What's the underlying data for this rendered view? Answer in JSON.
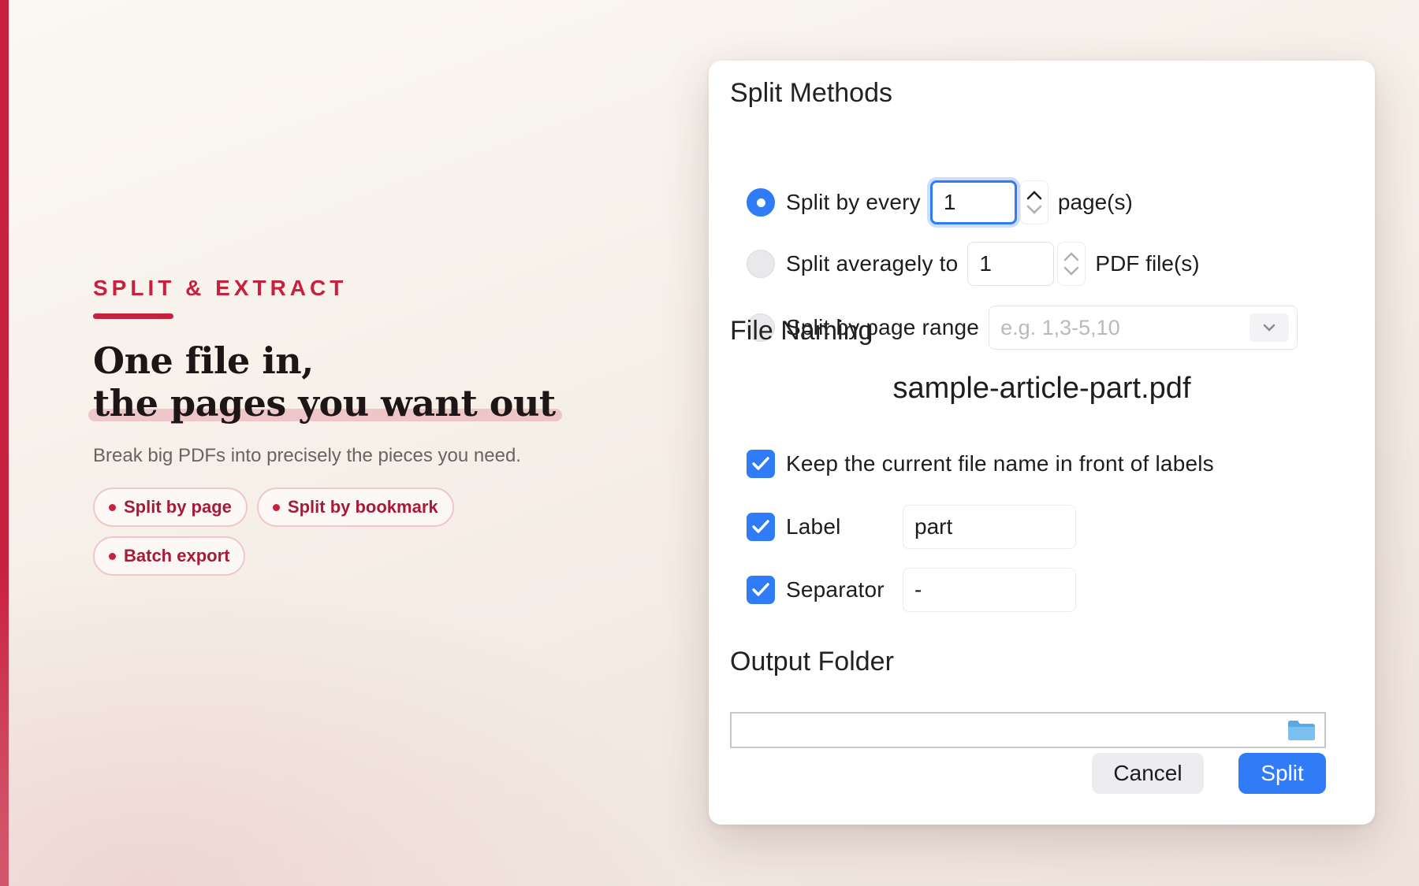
{
  "hero": {
    "eyebrow": "SPLIT & EXTRACT",
    "headline_line1": "One file in,",
    "headline_line2": "the pages you want out",
    "subtitle": "Break big PDFs into precisely the pieces you need.",
    "chips": [
      "Split by page",
      "Split by bookmark",
      "Batch export"
    ]
  },
  "dialog": {
    "split_methods": {
      "title": "Split Methods",
      "every": {
        "label": "Split by every",
        "value": "1",
        "unit": "page(s)",
        "selected": true
      },
      "average": {
        "label": "Split averagely to",
        "value": "1",
        "unit": "PDF file(s)",
        "selected": false
      },
      "range": {
        "label": "Split by page range",
        "placeholder": "e.g. 1,3-5,10",
        "selected": false
      }
    },
    "file_naming": {
      "title": "File Naming",
      "preview": "sample-article-part.pdf",
      "keep_name_label": "Keep the current file name in front of labels",
      "label_label": "Label",
      "label_value": "part",
      "separator_label": "Separator",
      "separator_value": "-"
    },
    "output": {
      "title": "Output Folder",
      "path": ""
    },
    "buttons": {
      "cancel": "Cancel",
      "split": "Split"
    }
  },
  "colors": {
    "accent": "#c8203f",
    "primary": "#2f7cf6"
  },
  "icons": [
    "radio-icon",
    "chevron-up-icon",
    "chevron-down-icon",
    "checkmark-icon",
    "folder-icon"
  ]
}
